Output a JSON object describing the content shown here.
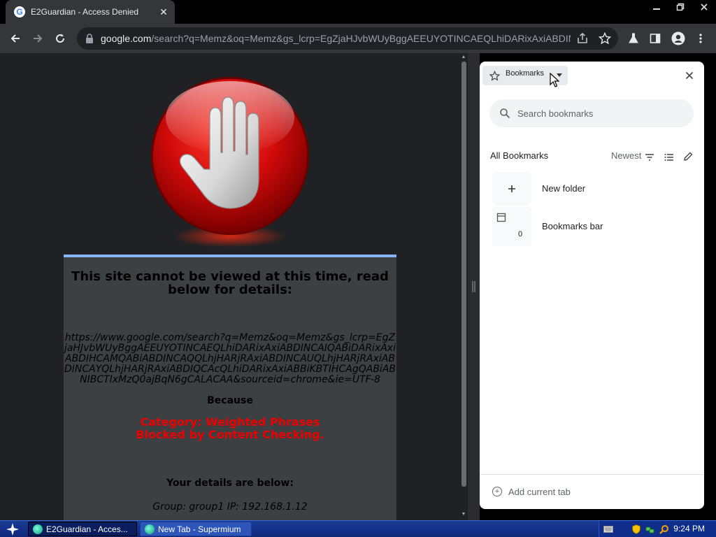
{
  "browser": {
    "tab": {
      "title": "E2Guardian - Access Denied",
      "favicon": "G"
    },
    "omnibox": {
      "host": "google.com",
      "path": "/search?q=Memz&oq=Memz&gs_lcrp=EgZjaHJvbWUyBggAEEUYOTINCAEQLhiDARixAxiABDINC..."
    },
    "window_controls": [
      "minimize-icon",
      "restore-icon",
      "close-icon"
    ]
  },
  "page": {
    "title": "This site cannot be viewed at this time, read below for details:",
    "blocked_url": "https://www.google.com/search?q=Memz&oq=Memz&gs_lcrp=EgZjaHJvbWUyBggAEEUYOTINCAEQLhiDARixAxiABDINCAIQABiDARixAxiABDIHCAMQABiABDINCAQQLhjHARjRAxiABDINCAUQLhjHARjRAxiABDINCAYQLhjHARjRAxiABDIQCAcQLhiDARixAxiABBiKBTIHCAgQABiABNIBCTIxMzQ0ajBqN6gCALACAA&sourceid=chrome&ie=UTF-8",
    "because_label": "Because",
    "category_line1": "Category: Weighted Phrases",
    "category_line2": "Blocked by Content Checking.",
    "details_label": "Your details are below:",
    "group_line": "Group: group1   IP: 192.168.1.12"
  },
  "side_panel": {
    "dropdown_label": "Bookmarks",
    "search_placeholder": "Search bookmarks",
    "section_title": "All Bookmarks",
    "sort_label": "Newest",
    "items": [
      {
        "name": "New folder",
        "icon": "plus-icon"
      },
      {
        "name": "Bookmarks bar",
        "icon": "folder-icon",
        "count": "0"
      }
    ],
    "footer_button": "Add current tab"
  },
  "taskbar": {
    "buttons": [
      {
        "label": "E2Guardian - Acces...",
        "active": true
      },
      {
        "label": "New Tab - Supermium",
        "active": false
      }
    ],
    "clock": "9:24 PM"
  },
  "colors": {
    "page_bg": "#202124",
    "card_bg": "#3c4043",
    "card_accent": "#8ab4f8",
    "category_red": "#e00000",
    "taskbar_blue": "#14308a"
  }
}
